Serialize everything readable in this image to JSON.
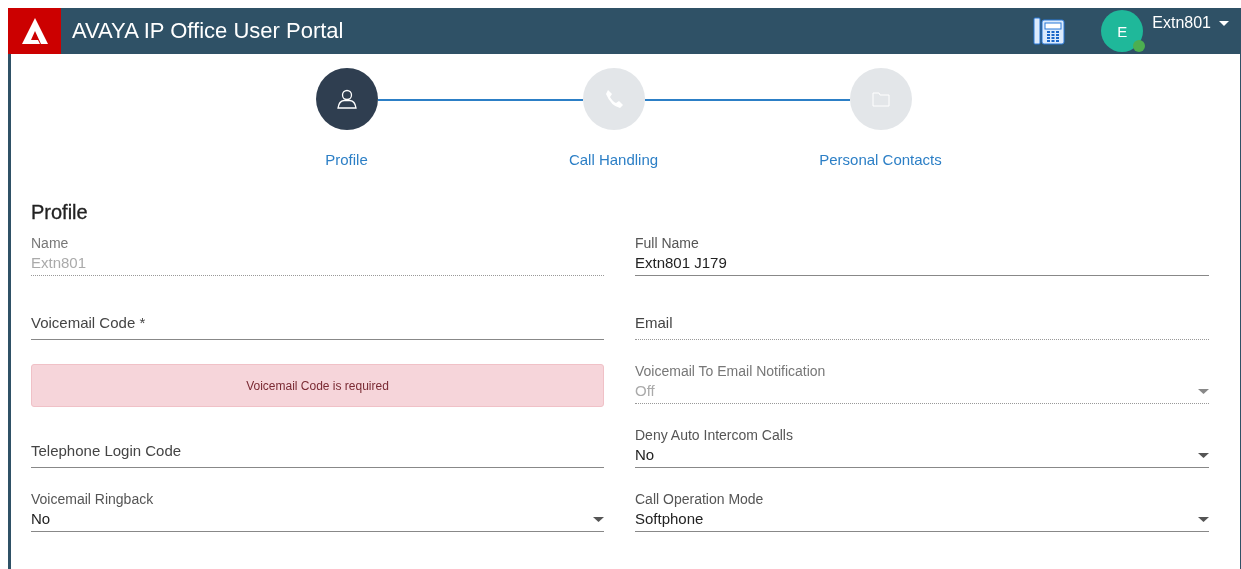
{
  "header": {
    "title": "AVAYA IP Office User Portal",
    "user": {
      "initial": "E",
      "name": "Extn801",
      "online": true
    }
  },
  "steps": [
    {
      "label": "Profile",
      "kind": "person",
      "selected": true
    },
    {
      "label": "Call Handling",
      "kind": "phone",
      "selected": false
    },
    {
      "label": "Personal Contacts",
      "kind": "folder",
      "selected": false
    }
  ],
  "section": {
    "title": "Profile"
  },
  "left": [
    {
      "kind": "text",
      "label": "Name",
      "value": "Extn801",
      "disabled": true
    },
    {
      "kind": "text",
      "label": "Voicemail Code *",
      "disabled": false
    },
    {
      "kind": "alert",
      "text": "Voicemail Code is required"
    },
    {
      "kind": "text",
      "label": "Telephone Login Code",
      "disabled": false
    },
    {
      "kind": "select",
      "label": "Voicemail Ringback",
      "value": "No",
      "disabled": false
    }
  ],
  "right": [
    {
      "kind": "text",
      "label": "Full Name",
      "value": "Extn801 J179",
      "disabled": false
    },
    {
      "kind": "text",
      "label": "Email",
      "disabled": true
    },
    {
      "kind": "select",
      "label": "Voicemail To Email Notification",
      "value": "Off",
      "disabled": true
    },
    {
      "kind": "select",
      "label": "Deny Auto Intercom Calls",
      "value": "No",
      "disabled": false
    },
    {
      "kind": "select",
      "label": "Call Operation Mode",
      "value": "Softphone",
      "disabled": false
    }
  ]
}
